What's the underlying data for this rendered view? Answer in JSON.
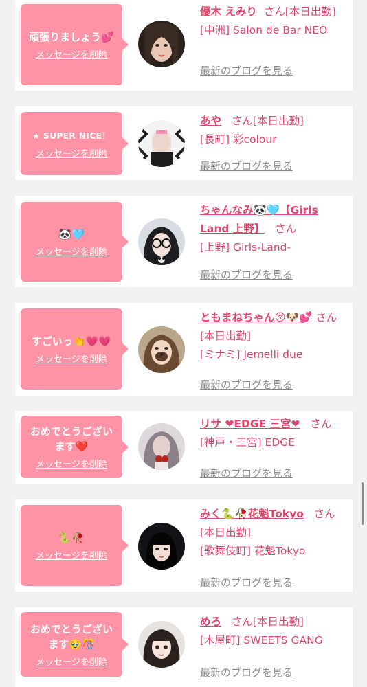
{
  "accent_color": "#e2456b",
  "bubble_color": "#ff93a6",
  "delete_label": "メッセージを削除",
  "blog_label": "最新のブログを見る",
  "cards": [
    {
      "message": "頑張りましょう💕",
      "name": "優木 えみり",
      "suffix": "さん[本日出勤]",
      "shop": "[中洲] Salon de Bar NEO"
    },
    {
      "message": "★ SUPER NICE！",
      "name": "あや",
      "suffix": "さん[本日出勤]",
      "shop": "[長町] 彩colour"
    },
    {
      "message": "🐼🩵",
      "name": "ちゃんなみ🐼🩵【Girls Land 上野】",
      "suffix": "さん",
      "shop": "[上野] Girls-Land-"
    },
    {
      "message": "すごいっ👏💗💗",
      "name": "ともまねちゃん😚🐶💕",
      "suffix": "さん[本日出勤]",
      "shop": "[ミナミ] Jemelli due"
    },
    {
      "message": "おめでとうございます❤️",
      "name": "リサ ❤EDGE 三宮❤",
      "suffix": "さん",
      "shop": "[神戸・三宮] EDGE"
    },
    {
      "message": "🐍🥀",
      "name": "みく🐍🥀花魁Tokyo",
      "suffix": "さん[本日出勤]",
      "shop": "[歌舞伎町] 花魁Tokyo"
    },
    {
      "message": "おめでとうございます🥹🎊",
      "name": "めろ",
      "suffix": "さん[本日出勤]",
      "shop": "[木屋町] SWEETS GANG"
    }
  ]
}
